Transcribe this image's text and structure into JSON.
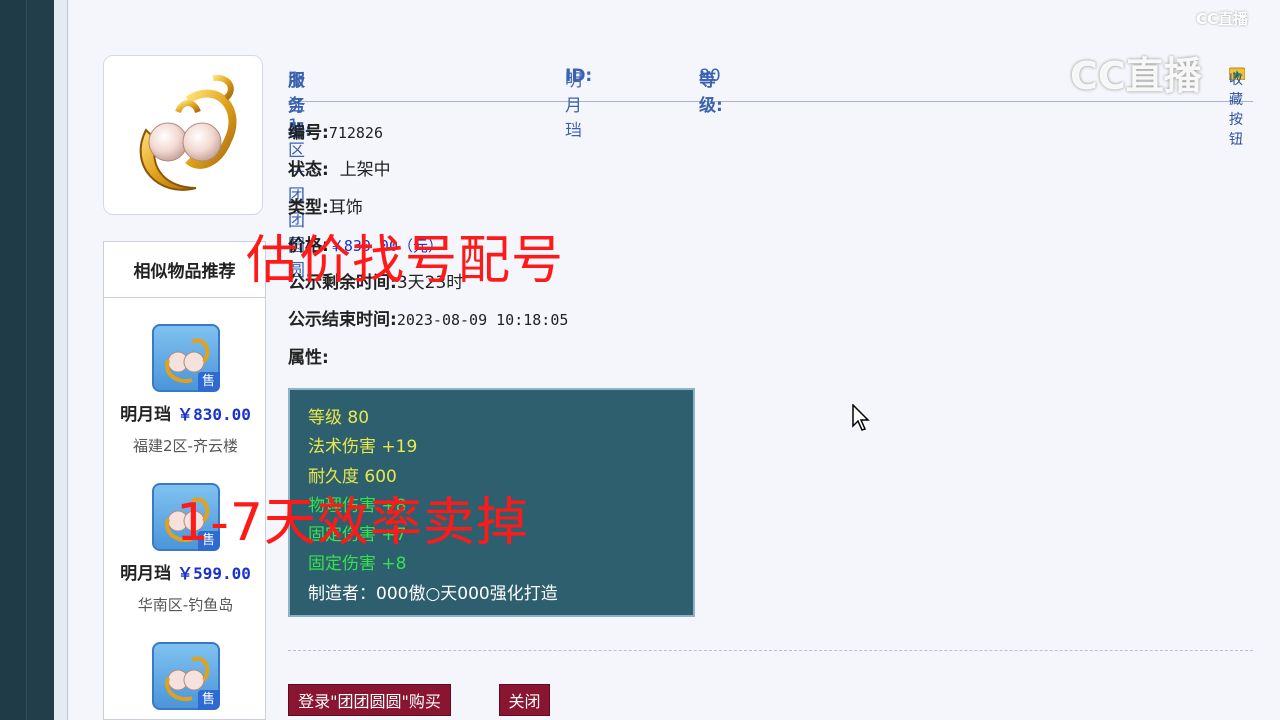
{
  "item": {
    "server_label": "服务器:",
    "server_value": "浙江1区—团团圆圆",
    "id_label": "ID:",
    "id_value": "明月珰",
    "level_label": "等级:",
    "level_value": "80",
    "fav_text": "收藏按钮"
  },
  "fields": {
    "number_label": "编号:",
    "number_value": "712826",
    "status_label": "状态:",
    "status_value": "上架中",
    "type_label": "类型:",
    "type_value": "耳饰",
    "price_label": "价格:",
    "price_value": "￥830.00（元）",
    "remaining_label": "公示剩余时间:",
    "remaining_value": "3天23时",
    "end_label": "公示结束时间:",
    "end_value": "2023-08-09 10:18:05",
    "attr_label": "属性:"
  },
  "attributes": [
    "等级 80",
    "法术伤害 +19",
    "耐久度 600",
    "物理伤害 +8",
    "固定伤害 +7",
    "固定伤害 +8",
    "制造者：000傲○天000强化打造"
  ],
  "sidebar": {
    "title": "相似物品推荐",
    "items": [
      {
        "name": "明月珰",
        "price": "￥830.00",
        "server": "福建2区-齐云楼",
        "badge": "售"
      },
      {
        "name": "明月珰",
        "price": "￥599.00",
        "server": "华南区-钓鱼岛",
        "badge": "售"
      },
      {
        "name": "",
        "price": "",
        "server": "",
        "badge": "售"
      }
    ]
  },
  "buttons": {
    "buy": "登录\"团团圆圆\"购买",
    "close": "关闭"
  },
  "overlay": {
    "text1": "估价找号配号",
    "text2": "1-7天效率卖掉"
  },
  "watermark": {
    "small": "CC直播",
    "big": "CC直播"
  },
  "colors": {
    "link_blue": "#3a62b0",
    "price_blue": "#1a33cc",
    "attr_bg": "#2e5f6e",
    "attr_yellow": "#e8e84a",
    "attr_green": "#34e34a",
    "button_red": "#8a1530",
    "overlay_red": "#ff1a1a"
  }
}
